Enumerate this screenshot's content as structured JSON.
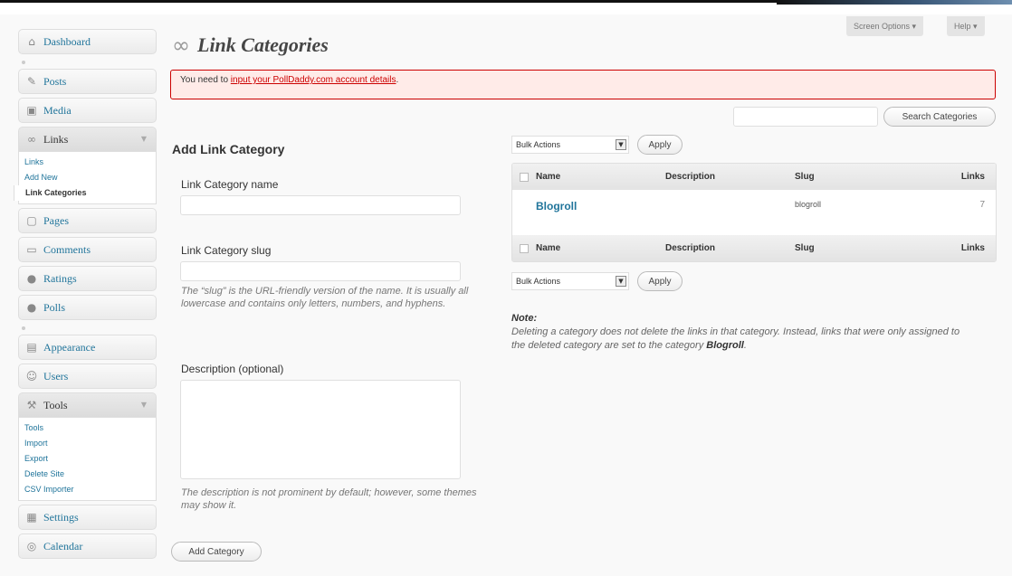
{
  "sidebar": {
    "dashboard": "Dashboard",
    "posts": "Posts",
    "media": "Media",
    "links": "Links",
    "links_sub": [
      "Links",
      "Add New",
      "Link Categories"
    ],
    "pages": "Pages",
    "comments": "Comments",
    "ratings": "Ratings",
    "polls": "Polls",
    "appearance": "Appearance",
    "users": "Users",
    "tools": "Tools",
    "tools_sub": [
      "Tools",
      "Import",
      "Export",
      "Delete Site",
      "CSV Importer"
    ],
    "settings": "Settings",
    "calendar": "Calendar"
  },
  "header": {
    "title": "Link Categories",
    "screen_options": "Screen Options ▾",
    "help": "Help ▾"
  },
  "notice": {
    "prefix": "You need to ",
    "link": "input your PollDaddy.com account details",
    "suffix": "."
  },
  "search": {
    "button": "Search Categories",
    "value": ""
  },
  "form": {
    "heading": "Add Link Category",
    "name_label": "Link Category name",
    "slug_label": "Link Category slug",
    "slug_help": "The “slug” is the URL-friendly version of the name. It is usually all lowercase and contains only letters, numbers, and hyphens.",
    "desc_label": "Description (optional)",
    "desc_help": "The description is not prominent by default; however, some themes may show it.",
    "submit": "Add Category"
  },
  "bulk": {
    "label": "Bulk Actions",
    "apply": "Apply"
  },
  "table": {
    "columns": [
      "Name",
      "Description",
      "Slug",
      "Links"
    ],
    "rows": [
      {
        "name": "Blogroll",
        "description": "",
        "slug": "blogroll",
        "links": "7"
      }
    ]
  },
  "note": {
    "heading": "Note:",
    "text": "Deleting a category does not delete the links in that category. Instead, links that were only assigned to the deleted category are set to the category ",
    "bold": "Blogroll",
    "end": "."
  }
}
